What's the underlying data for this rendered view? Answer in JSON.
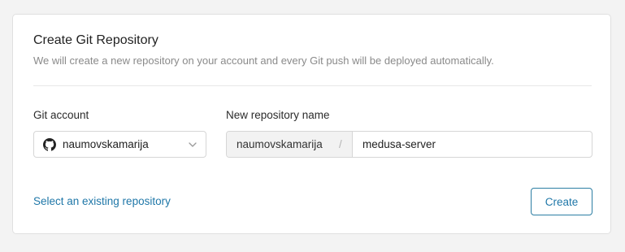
{
  "card": {
    "title": "Create Git Repository",
    "subtitle": "We will create a new repository on your account and every Git push will be deployed automatically."
  },
  "git_account": {
    "label": "Git account",
    "selected": "naumovskamarija",
    "icon": "github-icon"
  },
  "repository": {
    "label": "New repository name",
    "owner": "naumovskamarija",
    "separator": "/",
    "name_value": "medusa-server"
  },
  "actions": {
    "existing_link": "Select an existing repository",
    "create_label": "Create"
  },
  "colors": {
    "accent": "#1f77a8",
    "page_bg": "#f3f3f3",
    "card_bg": "#ffffff"
  }
}
